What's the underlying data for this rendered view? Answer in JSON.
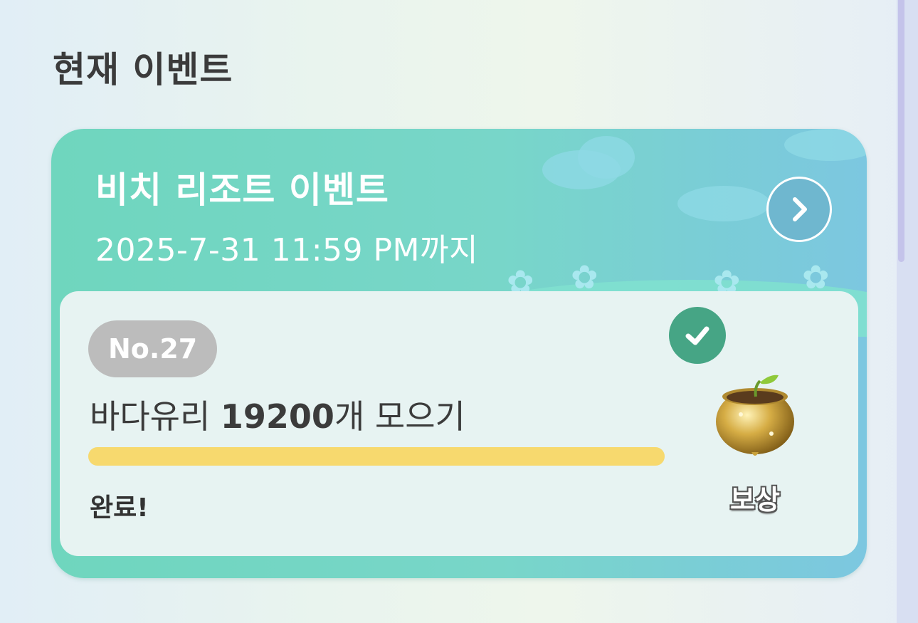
{
  "page": {
    "title": "현재 이벤트"
  },
  "event": {
    "title": "비치 리조트 이벤트",
    "deadline": "2025-7-31 11:59 PM까지",
    "next_icon": "chevron-right-icon"
  },
  "mission": {
    "number": "No.27",
    "text_prefix": "바다유리 ",
    "count": "19200",
    "text_suffix": "개 모으기",
    "progress": 1.0,
    "status": "완료!",
    "completed_icon": "check-icon",
    "reward_icon": "golden-pot-icon",
    "reward_label": "보상"
  },
  "colors": {
    "card_gradient_start": "#6fd6be",
    "card_gradient_end": "#7cc7e0",
    "progress_fill": "#f7d96e",
    "check_badge": "#46a585",
    "number_badge": "#bcbcbc"
  }
}
